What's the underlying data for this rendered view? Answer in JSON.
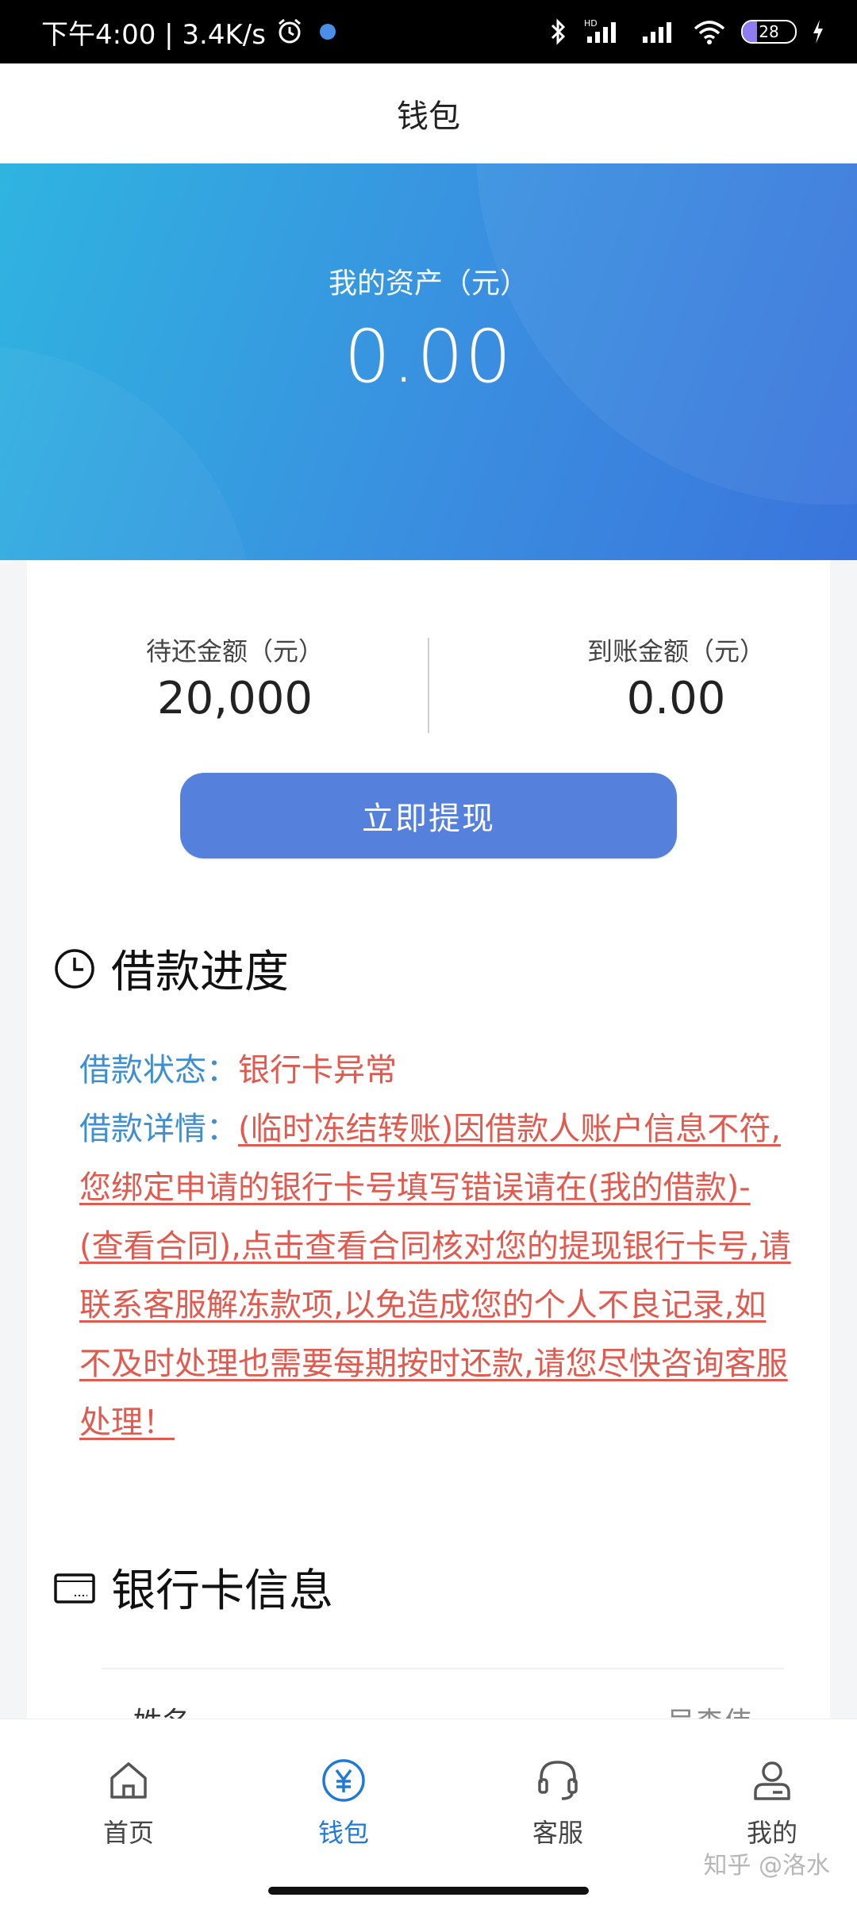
{
  "status_bar": {
    "time_speed": "下午4:00 | 3.4K/s",
    "battery": "28",
    "network_hd": "HD"
  },
  "header": {
    "title": "钱包"
  },
  "hero": {
    "label": "我的资产（元）",
    "amount": "0.00"
  },
  "stats": {
    "pending_label": "待还金额（元）",
    "pending_value": "20,000",
    "arrived_label": "到账金额（元）",
    "arrived_value": "0.00"
  },
  "withdraw_button": "立即提现",
  "progress": {
    "title": "借款进度",
    "status_key": "借款状态：",
    "status_value": "银行卡异常",
    "detail_key": "借款详情：",
    "detail_value": "(临时冻结转账)因借款人账户信息不符,您绑定申请的银行卡号填写错误请在(我的借款)-(查看合同),点击查看合同核对您的提现银行卡号,请联系客服解冻款项,以免造成您的个人不良记录,如不及时处理也需要每期按时还款,请您尽快咨询客服处理！"
  },
  "bank": {
    "title": "银行卡信息",
    "name_label": "姓名",
    "name_value": "吴森伟"
  },
  "nav": [
    {
      "label": "首页",
      "icon": "home-icon"
    },
    {
      "label": "钱包",
      "icon": "wallet-icon"
    },
    {
      "label": "客服",
      "icon": "headset-icon"
    },
    {
      "label": "我的",
      "icon": "profile-icon"
    }
  ],
  "watermark": "知乎 @洛水",
  "colors": {
    "accent": "#5581dc",
    "nav_active": "#1f79d8",
    "warning_red": "#e05b4f",
    "key_blue": "#3f8fd0"
  }
}
